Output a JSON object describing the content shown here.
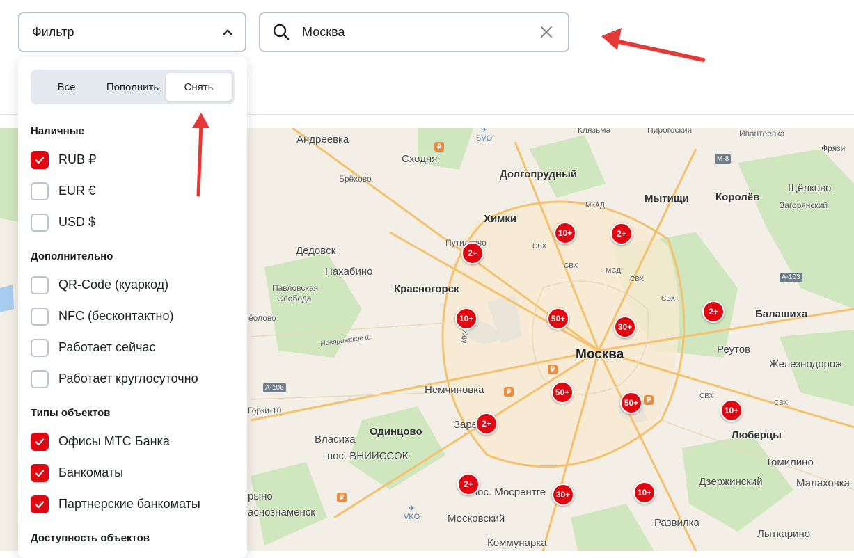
{
  "filter": {
    "label": "Фильтр"
  },
  "search": {
    "value": "Москва",
    "placeholder": ""
  },
  "segments": [
    {
      "label": "Все",
      "active": false
    },
    {
      "label": "Пополнить",
      "active": false
    },
    {
      "label": "Снять",
      "active": true
    }
  ],
  "sections": {
    "cash": {
      "title": "Наличные",
      "items": [
        {
          "label": "RUB ₽",
          "checked": true
        },
        {
          "label": "EUR €",
          "checked": false
        },
        {
          "label": "USD $",
          "checked": false
        }
      ]
    },
    "extra": {
      "title": "Дополнительно",
      "items": [
        {
          "label": "QR-Code (куаркод)",
          "checked": false
        },
        {
          "label": "NFC (бесконтактно)",
          "checked": false
        },
        {
          "label": "Работает сейчас",
          "checked": false
        },
        {
          "label": "Работает круглосуточно",
          "checked": false
        }
      ]
    },
    "types": {
      "title": "Типы объектов",
      "items": [
        {
          "label": "Офисы МТС Банка",
          "checked": true
        },
        {
          "label": "Банкоматы",
          "checked": true
        },
        {
          "label": "Партнерские банкоматы",
          "checked": true
        }
      ]
    },
    "access": {
      "title": "Доступность объектов"
    }
  },
  "map": {
    "labels": {
      "andreevka": "Андреевка",
      "shodnya": "Сходня",
      "brekhovo": "Брёхово",
      "dolgoprudny": "Долгопрудный",
      "khimki": "Химки",
      "mytishchi": "Мытищи",
      "korolev": "Королёв",
      "shchelkovo": "Щёлково",
      "zagoryansky": "Загорянский",
      "ivanteevka": "Ивантеевка",
      "pirogovsky": "Пирогоский",
      "klyazma": "Клязьма",
      "fryazino": "Фрязи",
      "putilkovo": "Путилково",
      "dedovsk": "Дедовск",
      "nakhabino": "Нахабино",
      "krasnogorsk": "Красногорск",
      "pavlovskaya": "Павловская",
      "sloboda": "Слобода",
      "seolovo": "ёолово",
      "novorizhskoe": "Новорижское ш.",
      "moskva": "Москва",
      "balashikha": "Балашиха",
      "reutov": "Реутов",
      "zheleznodorozhny": "Железнодорож",
      "nemchinovka": "Немчиновка",
      "gorki": "Горки-10",
      "odintsovo": "Одинцово",
      "vlasikha": "Власиха",
      "vniissok": "пос. ВНИИССОК",
      "zarechye": "Заре",
      "lyubertsy": "Люберцы",
      "tomilino": "Томилино",
      "dzerzhinsky": "Дзержинский",
      "malakhovka": "Малаховка",
      "mosrentgen": "пос. Мосрентге",
      "moskovsky": "Московский",
      "razvilka": "Развилка",
      "lytkarino": "Лыткарино",
      "kommunarka": "Коммунарка",
      "ryno": "рыно",
      "krasnoznamensk": "аснознаменск",
      "svo": "SVO",
      "vko": "VKO",
      "mkad": "МКАД",
      "mkad2": "МКАД",
      "svh1": "СВХ",
      "svh2": "СВХ",
      "svh3": "СВХ",
      "svh4": "СВХ",
      "svh5": "СВХ",
      "svh6": "СВХ",
      "mcd": "МСД"
    },
    "highways": {
      "m8": "М-8",
      "a103": "А-103",
      "a106": "А-106"
    },
    "clusters": [
      "10+",
      "2+",
      "2+",
      "10+",
      "50+",
      "30+",
      "2+",
      "50+",
      "50+",
      "10+",
      "2+",
      "2+",
      "30+",
      "10+"
    ]
  }
}
